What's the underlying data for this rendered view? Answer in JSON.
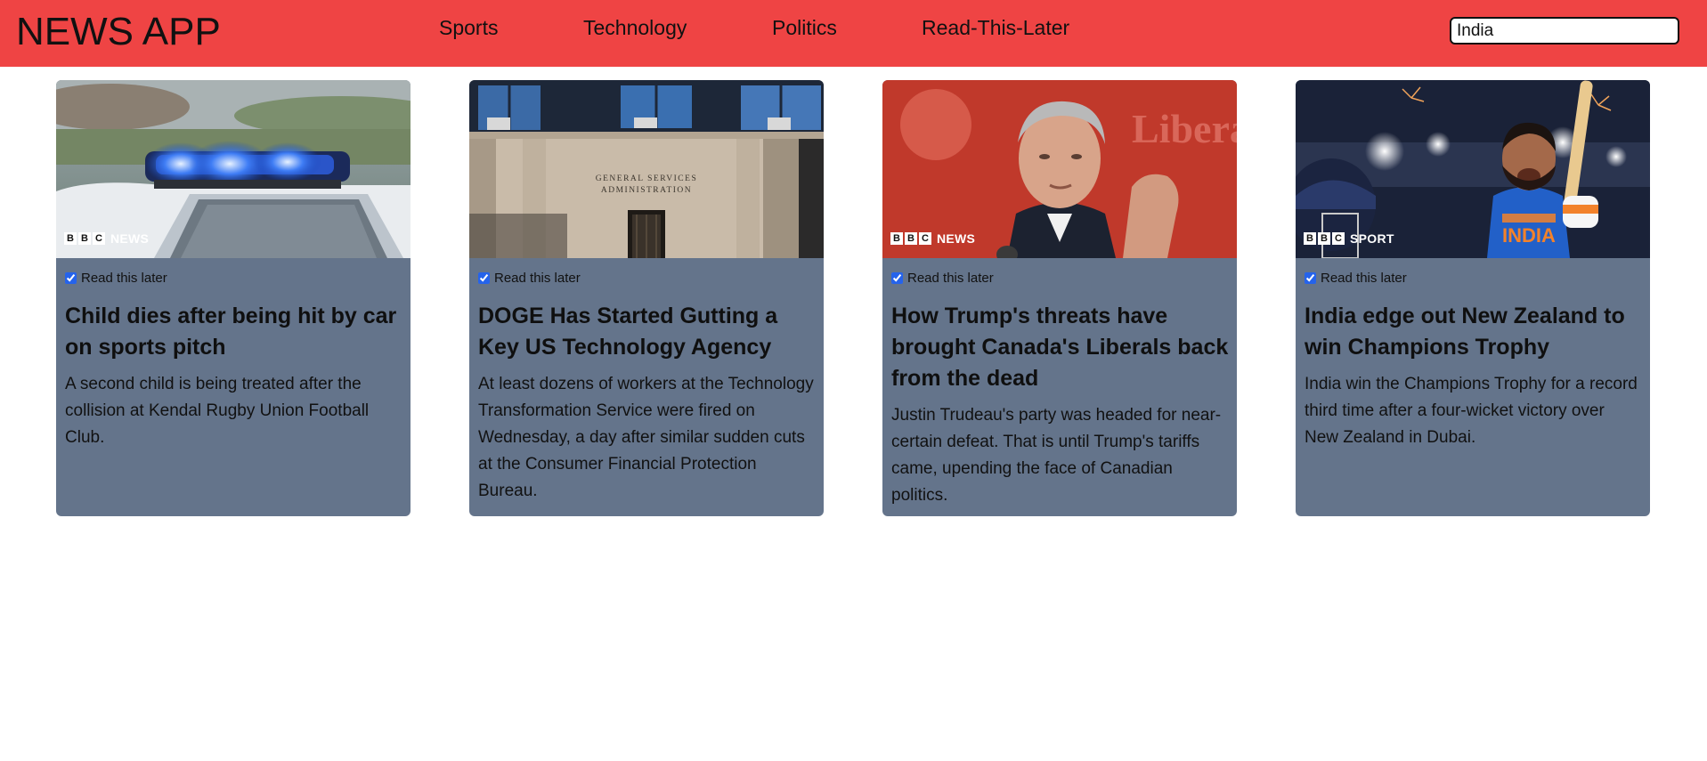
{
  "header": {
    "brand": "NEWS APP",
    "nav": [
      "Sports",
      "Technology",
      "Politics",
      "Read-This-Later"
    ],
    "search_value": "India",
    "background_color": "#ef4444"
  },
  "articles": [
    {
      "image_icon": "police-car-icon",
      "badge_brand": "BBC",
      "badge_label": "NEWS",
      "read_later_label": "Read this later",
      "read_later_checked": true,
      "title": "Child dies after being hit by car on sports pitch",
      "description": "A second child is being treated after the collision at Kendal Rugby Union Football Club."
    },
    {
      "image_icon": "government-building-icon",
      "badge_brand": "",
      "badge_label": "",
      "building_sign": "GENERAL SERVICES ADMINISTRATION",
      "read_later_label": "Read this later",
      "read_later_checked": true,
      "title": "DOGE Has Started Gutting a Key US Technology Agency",
      "description": "At least dozens of workers at the Technology Transformation Service were fired on Wednesday, a day after similar sudden cuts at the Consumer Financial Protection Bureau."
    },
    {
      "image_icon": "politician-portrait-icon",
      "badge_brand": "BBC",
      "badge_label": "NEWS",
      "backdrop_text": "Liberal",
      "read_later_label": "Read this later",
      "read_later_checked": true,
      "title": "How Trump's threats have brought Canada's Liberals back from the dead",
      "description": "Justin Trudeau's party was headed for near-certain defeat. That is until Trump's tariffs came, upending the face of Canadian politics."
    },
    {
      "image_icon": "cricket-celebration-icon",
      "badge_brand": "BBC",
      "badge_label": "SPORT",
      "jersey_text": "INDIA",
      "read_later_label": "Read this later",
      "read_later_checked": true,
      "title": "India edge out New Zealand to win Champions Trophy",
      "description": "India win the Champions Trophy for a record third time after a four-wicket victory over New Zealand in Dubai."
    }
  ]
}
